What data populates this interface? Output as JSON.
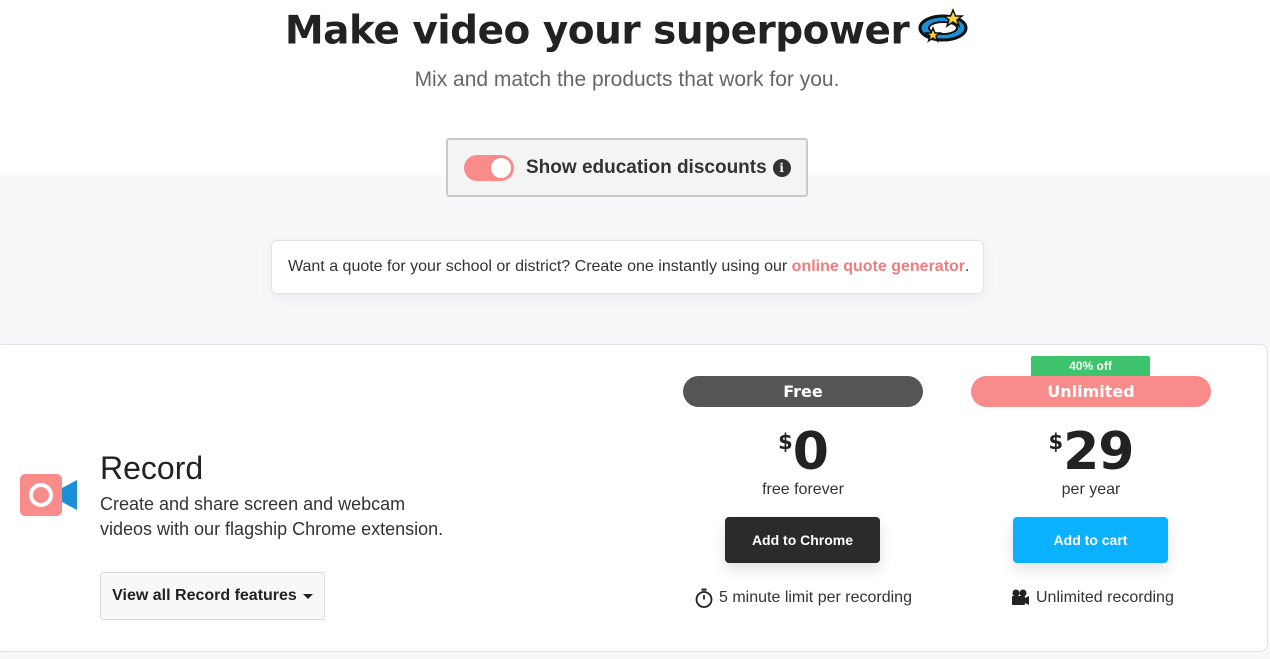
{
  "hero": {
    "title": "Make video your superpower",
    "subtitle": "Mix and match the products that work for you."
  },
  "education_toggle": {
    "label": "Show education discounts",
    "on": true
  },
  "quote": {
    "text": "Want a quote for your school or district? Create one instantly using our ",
    "link": "online quote generator",
    "suffix": "."
  },
  "product": {
    "name": "Record",
    "description": "Create and share screen and webcam videos with our flagship Chrome extension.",
    "features_button": "View all Record features",
    "icon": "camera-icon"
  },
  "plans": {
    "free": {
      "label": "Free",
      "currency": "$",
      "price": "0",
      "period": "free forever",
      "cta": "Add to Chrome",
      "feature": "5 minute limit per recording",
      "feature_icon": "stopwatch-icon"
    },
    "unlimited": {
      "label": "Unlimited",
      "badge": "40% off",
      "currency": "$",
      "price": "29",
      "period": "per year",
      "cta": "Add to cart",
      "feature": "Unlimited recording",
      "feature_icon": "film-camera-icon"
    }
  },
  "colors": {
    "accent": "#f98b8b",
    "free_pill": "#555555",
    "badge_green": "#3ec46d",
    "cart_blue": "#0ab1ff",
    "chrome_button": "#2b2b2b"
  }
}
